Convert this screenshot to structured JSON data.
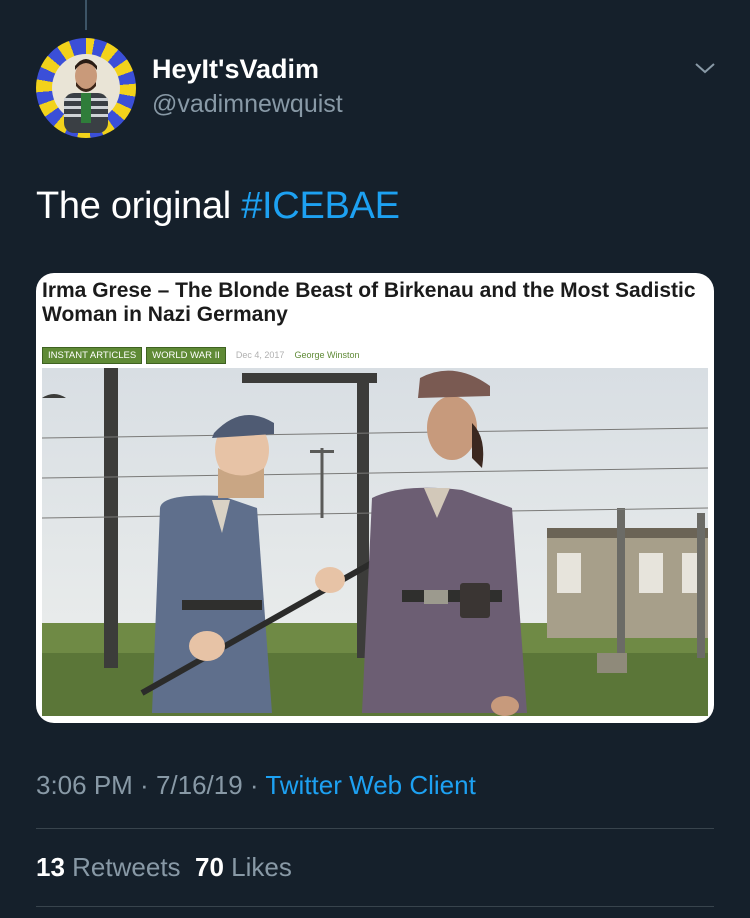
{
  "author": {
    "display_name": "HeyIt'sVadim",
    "handle": "@vadimnewquist"
  },
  "tweet": {
    "text_prefix": "The original ",
    "hashtag": "#ICEBAE"
  },
  "card": {
    "headline": "Irma Grese – The Blonde Beast of Birkenau and the Most Sadistic Woman in Nazi Germany",
    "tags": [
      "INSTANT ARTICLES",
      "WORLD WAR II"
    ],
    "date": "Dec 4, 2017",
    "author": "George Winston"
  },
  "meta": {
    "time": "3:06 PM",
    "sep1": " · ",
    "date": "7/16/19",
    "sep2": " · ",
    "client": "Twitter Web Client"
  },
  "stats": {
    "retweets_count": "13",
    "retweets_label": "Retweets",
    "likes_count": "70",
    "likes_label": "Likes"
  },
  "colors": {
    "background": "#15202b",
    "link": "#1da1f2",
    "secondary_text": "#8899a6",
    "tag_green": "#5f8a36"
  }
}
